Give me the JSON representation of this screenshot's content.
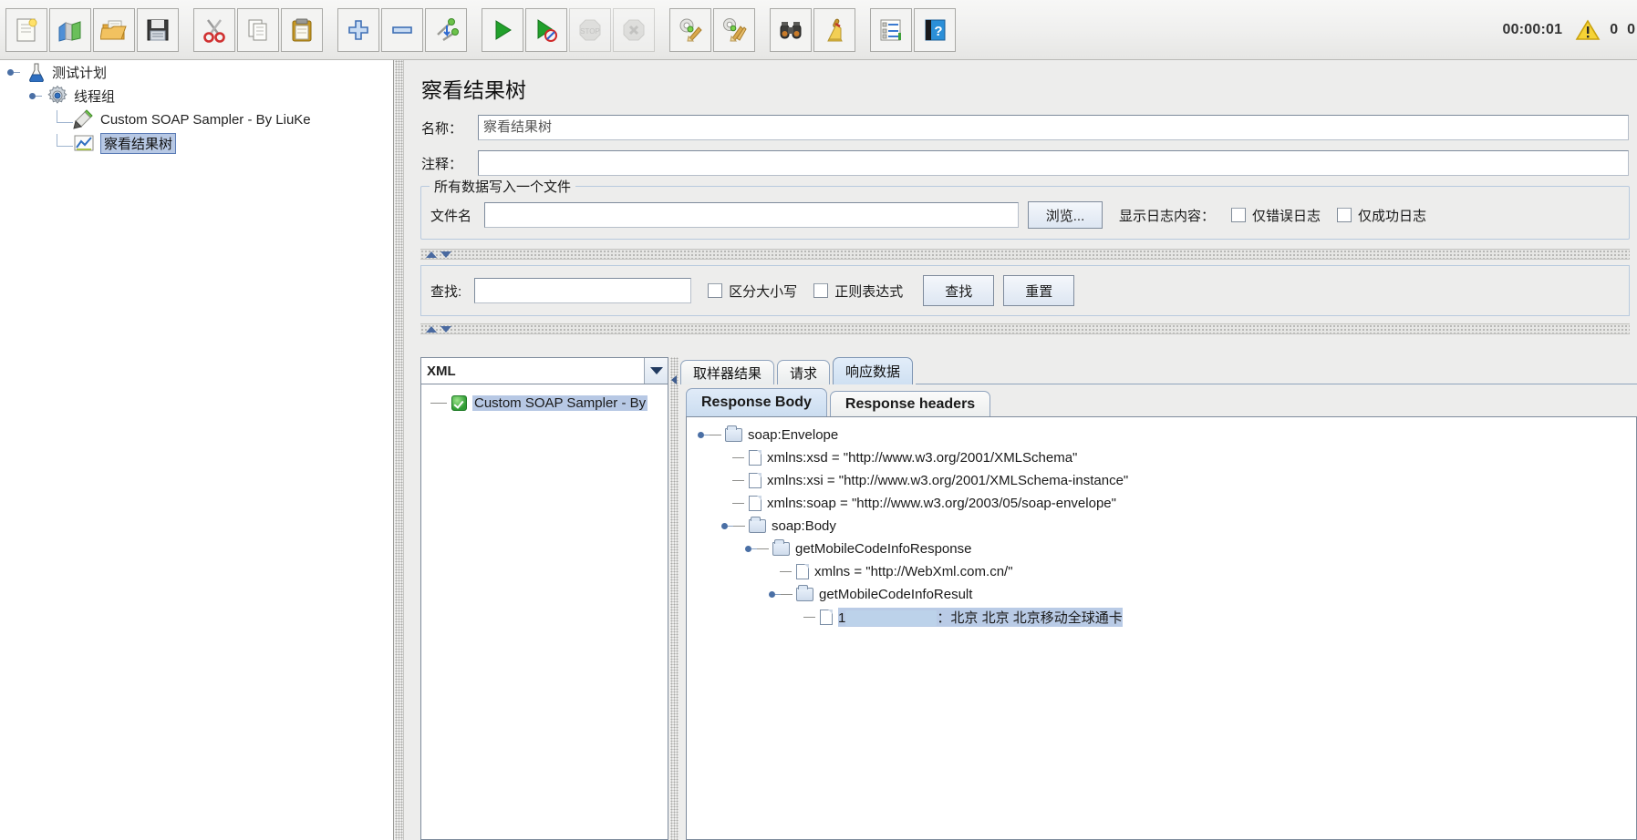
{
  "toolbar": {
    "buttons": [
      {
        "name": "new-test-plan",
        "icon": "new-document-icon",
        "enabled": true
      },
      {
        "name": "templates",
        "icon": "templates-icon",
        "enabled": true
      },
      {
        "name": "open",
        "icon": "open-folder-icon",
        "enabled": true
      },
      {
        "name": "save",
        "icon": "save-floppy-icon",
        "enabled": true
      },
      {
        "name": "cut",
        "icon": "scissors-icon",
        "enabled": true
      },
      {
        "name": "copy",
        "icon": "copy-pages-icon",
        "enabled": true
      },
      {
        "name": "paste",
        "icon": "clipboard-icon",
        "enabled": true
      },
      {
        "name": "expand-all",
        "icon": "plus-icon",
        "enabled": true
      },
      {
        "name": "collapse-all",
        "icon": "minus-icon",
        "enabled": true
      },
      {
        "name": "toggle",
        "icon": "toggle-icon",
        "enabled": true
      },
      {
        "name": "start",
        "icon": "play-green-icon",
        "enabled": true
      },
      {
        "name": "start-no-timers",
        "icon": "play-no-timers-icon",
        "enabled": true
      },
      {
        "name": "stop",
        "icon": "stop-sign-icon",
        "enabled": false
      },
      {
        "name": "shutdown",
        "icon": "shutdown-x-icon",
        "enabled": false
      },
      {
        "name": "clear",
        "icon": "gear-broom-icon",
        "enabled": true
      },
      {
        "name": "clear-all",
        "icon": "gear-broom-all-icon",
        "enabled": true
      },
      {
        "name": "search",
        "icon": "binoculars-icon",
        "enabled": true
      },
      {
        "name": "reset-search",
        "icon": "broom-icon",
        "enabled": true
      },
      {
        "name": "function-helper",
        "icon": "function-list-icon",
        "enabled": true
      },
      {
        "name": "help",
        "icon": "help-book-icon",
        "enabled": true
      }
    ],
    "elapsed_time": "00:00:01",
    "warning_count": "0",
    "thread_count": "0",
    "warning_icon": "warning-triangle-icon"
  },
  "tree": {
    "nodes": [
      {
        "label": "测试计划",
        "icon": "flask-icon",
        "depth": 0,
        "selected": false,
        "expander": true
      },
      {
        "label": "线程组",
        "icon": "gear-icon",
        "depth": 1,
        "selected": false,
        "expander": true
      },
      {
        "label": "Custom SOAP Sampler - By LiuKe",
        "icon": "pen-icon",
        "depth": 2,
        "selected": false,
        "expander": false
      },
      {
        "label": "察看结果树",
        "icon": "chart-icon",
        "depth": 2,
        "selected": true,
        "expander": false
      }
    ]
  },
  "panel": {
    "title": "察看结果树",
    "name_label": "名称：",
    "name_value": "察看结果树",
    "comment_label": "注释：",
    "comment_value": "",
    "filegroup": {
      "title": "所有数据写入一个文件",
      "filename_label": "文件名",
      "filename_value": "",
      "browse_label": "浏览...",
      "log_display_label": "显示日志内容：",
      "errors_only_label": "仅错误日志",
      "errors_only_checked": false,
      "success_only_label": "仅成功日志",
      "success_only_checked": false
    },
    "search": {
      "find_label": "查找:",
      "find_value": "",
      "case_label": "区分大小写",
      "case_checked": false,
      "regex_label": "正则表达式",
      "regex_checked": false,
      "search_button": "查找",
      "reset_button": "重置"
    },
    "renderer": {
      "selected": "XML",
      "dropdown_icon": "chevron-down-icon"
    },
    "results": [
      {
        "label": "Custom SOAP Sampler - By",
        "status": "ok",
        "selected": true,
        "status_icon": "success-check-icon"
      }
    ],
    "tabs": [
      {
        "label": "取样器结果",
        "active": false
      },
      {
        "label": "请求",
        "active": false
      },
      {
        "label": "响应数据",
        "active": true
      }
    ],
    "subtabs": [
      {
        "label": "Response Body",
        "active": true
      },
      {
        "label": "Response headers",
        "active": false
      }
    ],
    "xml_tree": [
      {
        "depth": 0,
        "type": "folder",
        "expander": true,
        "text": "soap:Envelope"
      },
      {
        "depth": 1,
        "type": "doc",
        "expander": false,
        "text": "xmlns:xsd = \"http://www.w3.org/2001/XMLSchema\""
      },
      {
        "depth": 1,
        "type": "doc",
        "expander": false,
        "text": "xmlns:xsi = \"http://www.w3.org/2001/XMLSchema-instance\""
      },
      {
        "depth": 1,
        "type": "doc",
        "expander": false,
        "text": "xmlns:soap = \"http://www.w3.org/2003/05/soap-envelope\""
      },
      {
        "depth": 1,
        "type": "folder",
        "expander": true,
        "text": "soap:Body"
      },
      {
        "depth": 2,
        "type": "folder",
        "expander": true,
        "text": "getMobileCodeInfoResponse"
      },
      {
        "depth": 3,
        "type": "doc",
        "expander": false,
        "text": "xmlns = \"http://WebXml.com.cn/\""
      },
      {
        "depth": 3,
        "type": "folder",
        "expander": true,
        "text": "getMobileCodeInfoResult"
      },
      {
        "depth": 4,
        "type": "doc",
        "expander": false,
        "text": "1",
        "redacted": "XXXXXXXXXX",
        "suffix": "：北京 北京 北京移动全球通卡",
        "highlight": true
      }
    ]
  },
  "colors": {
    "selection_blue": "#b7c8e4",
    "accent_blue": "#4a6fa5",
    "toolbar_bg": "#efefee",
    "panel_bg": "#ededec"
  }
}
